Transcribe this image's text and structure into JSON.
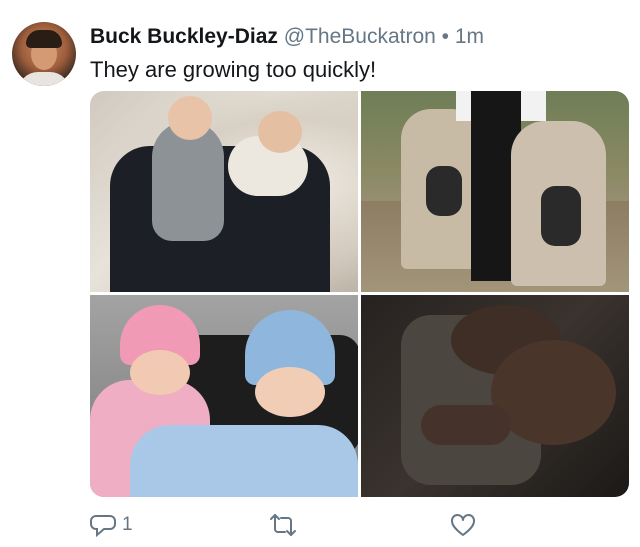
{
  "tweet": {
    "display_name": "Buck Buckley-Diaz",
    "handle": "@TheBuckatron",
    "separator": "•",
    "timestamp": "1m",
    "text": "They are growing too quickly!"
  },
  "media": {
    "photos": [
      {
        "name": "photo-father-with-twins"
      },
      {
        "name": "photo-twins-in-strollers"
      },
      {
        "name": "photo-twins-in-knit-hats"
      },
      {
        "name": "photo-newborns-close-up"
      }
    ]
  },
  "actions": {
    "reply_icon": "reply-icon",
    "reply_count": "1",
    "retweet_icon": "retweet-icon",
    "like_icon": "heart-icon"
  },
  "colors": {
    "text": "#14171a",
    "secondary": "#657786"
  }
}
